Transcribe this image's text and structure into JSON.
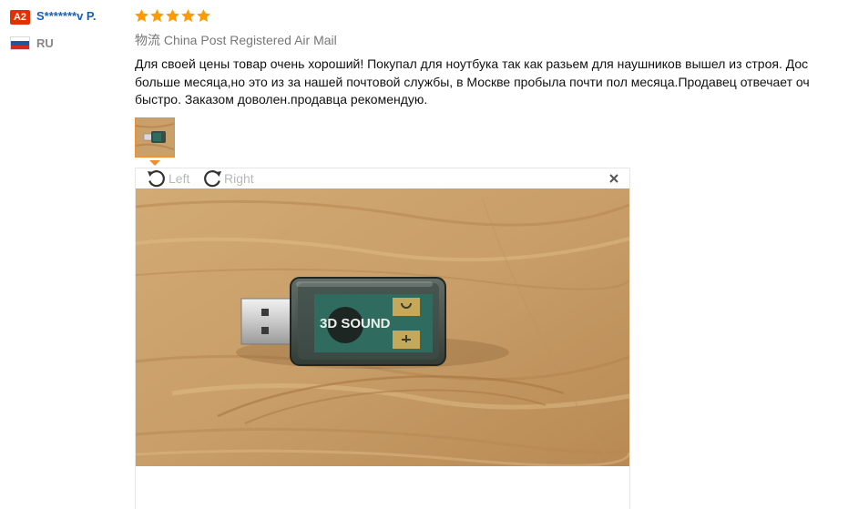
{
  "reviewer": {
    "level_badge": "A2",
    "name": "S*******v P.",
    "country_code": "RU"
  },
  "review": {
    "rating": 5,
    "rating_color": "#ff9a00",
    "logistics": "物流 China Post Registered Air Mail",
    "text_lines": [
      "Для своей цены товар очень хороший! Покупал для ноутбука так как разьем для наушников вышел из строя. Дос",
      "больше месяца,но это из за нашей почтовой службы, в Москве пробыла почти пол месяца.Продавец отвечает оч",
      "быстро. Заказом доволен.продавца рекомендую."
    ]
  },
  "viewer": {
    "rotate_left_label": "Left",
    "rotate_right_label": "Right",
    "photo_label": "3D SOUND",
    "accent_color": "#f08d2c"
  },
  "icons": {
    "star": "star-icon",
    "rotate_left": "rotate-left-icon",
    "rotate_right": "rotate-right-icon",
    "close": "close-icon",
    "flag": "russia-flag-icon"
  }
}
